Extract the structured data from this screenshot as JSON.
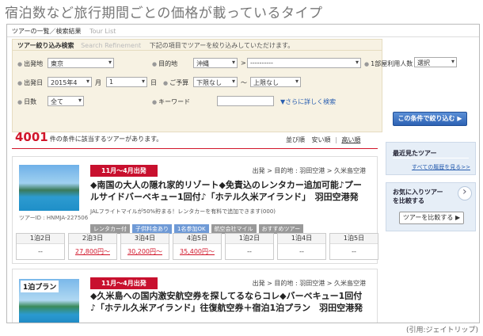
{
  "heading": "宿泊数など旅行期間ごとの価格が載っているタイプ",
  "caption": "(引用:ジェイトリップ)",
  "breadcrumb": {
    "label": "ツアーの一覧／検索結果",
    "en": "Tour List"
  },
  "filter": {
    "title": "ツアー絞り込み検索",
    "title_en": "Search Refinement",
    "description": "下記の項目でツアーを絞り込みしていただけます。",
    "departure_label": "出発地",
    "departure_value": "東京",
    "destination_label": "目的地",
    "destination_value1": "沖縄",
    "arrow": ">",
    "destination_value2": "----------",
    "room_label": "1部屋利用人数",
    "room_value": "選択",
    "date_label": "出発日",
    "year_month_value": "2015年4",
    "month_suffix": "月",
    "day_value": "1",
    "day_suffix": "日",
    "budget_label": "ご予算",
    "budget_min": "下限なし",
    "budget_tilde": "〜",
    "budget_max": "上限なし",
    "days_label": "日数",
    "days_value": "全て",
    "keyword_label": "キーワード",
    "more_link": "▼さらに詳しく検索",
    "search_button": "この条件で絞り込む ▶"
  },
  "results": {
    "count": "4001",
    "count_text": "件の条件に該当するツアーがあります。",
    "sort_label": "並び順",
    "sort_cheap": "安い順",
    "sort_sep": "|",
    "sort_expensive": "高い順"
  },
  "tours": [
    {
      "period": "11月〜4月出発",
      "route": "出発 > 目的地 :  羽田空港 > 久米島空港",
      "title": "◆南国の大人の隠れ家的リゾート◆免責込のレンタカー追加可能♪プールサイドバーベキュー1回付♪「ホテル久米アイランド」　羽田空港発",
      "tour_id": "ツアーID : HNMJA-227506",
      "note": "JALフライトマイルが50%貯まる！レンタカーを有料で追加できます(000)",
      "tags": [
        "レンタカー付",
        "子供料金あり",
        "1名参加OK",
        "航空会社マイル",
        "おすすめツアー"
      ],
      "days": [
        {
          "label": "1泊2日",
          "price": "--"
        },
        {
          "label": "2泊3日",
          "price": "27,800円〜"
        },
        {
          "label": "3泊4日",
          "price": "30,200円〜"
        },
        {
          "label": "4泊5日",
          "price": "35,400円〜"
        },
        {
          "label": "1泊2日",
          "price": "--"
        },
        {
          "label": "1泊4日",
          "price": "--"
        },
        {
          "label": "1泊5日",
          "price": "--"
        }
      ]
    },
    {
      "badge": "1泊プラン",
      "period": "11月〜4月出発",
      "route": "出発 > 目的地 :  羽田空港 > 久米島空港",
      "title": "◆久米島への国内激安航空券を探してるならコレ◆バーベキュー1回付♪「ホテル久米アイランド」往復航空券＋宿泊1泊プラン　羽田空港発"
    }
  ],
  "sidebar": {
    "recent_title": "最近見たツアー",
    "recent_link": "すべての履歴を見る>>",
    "favorites_title": "お気に入りツアーを比較する",
    "compare_button": "ツアーを比較する ▶"
  }
}
